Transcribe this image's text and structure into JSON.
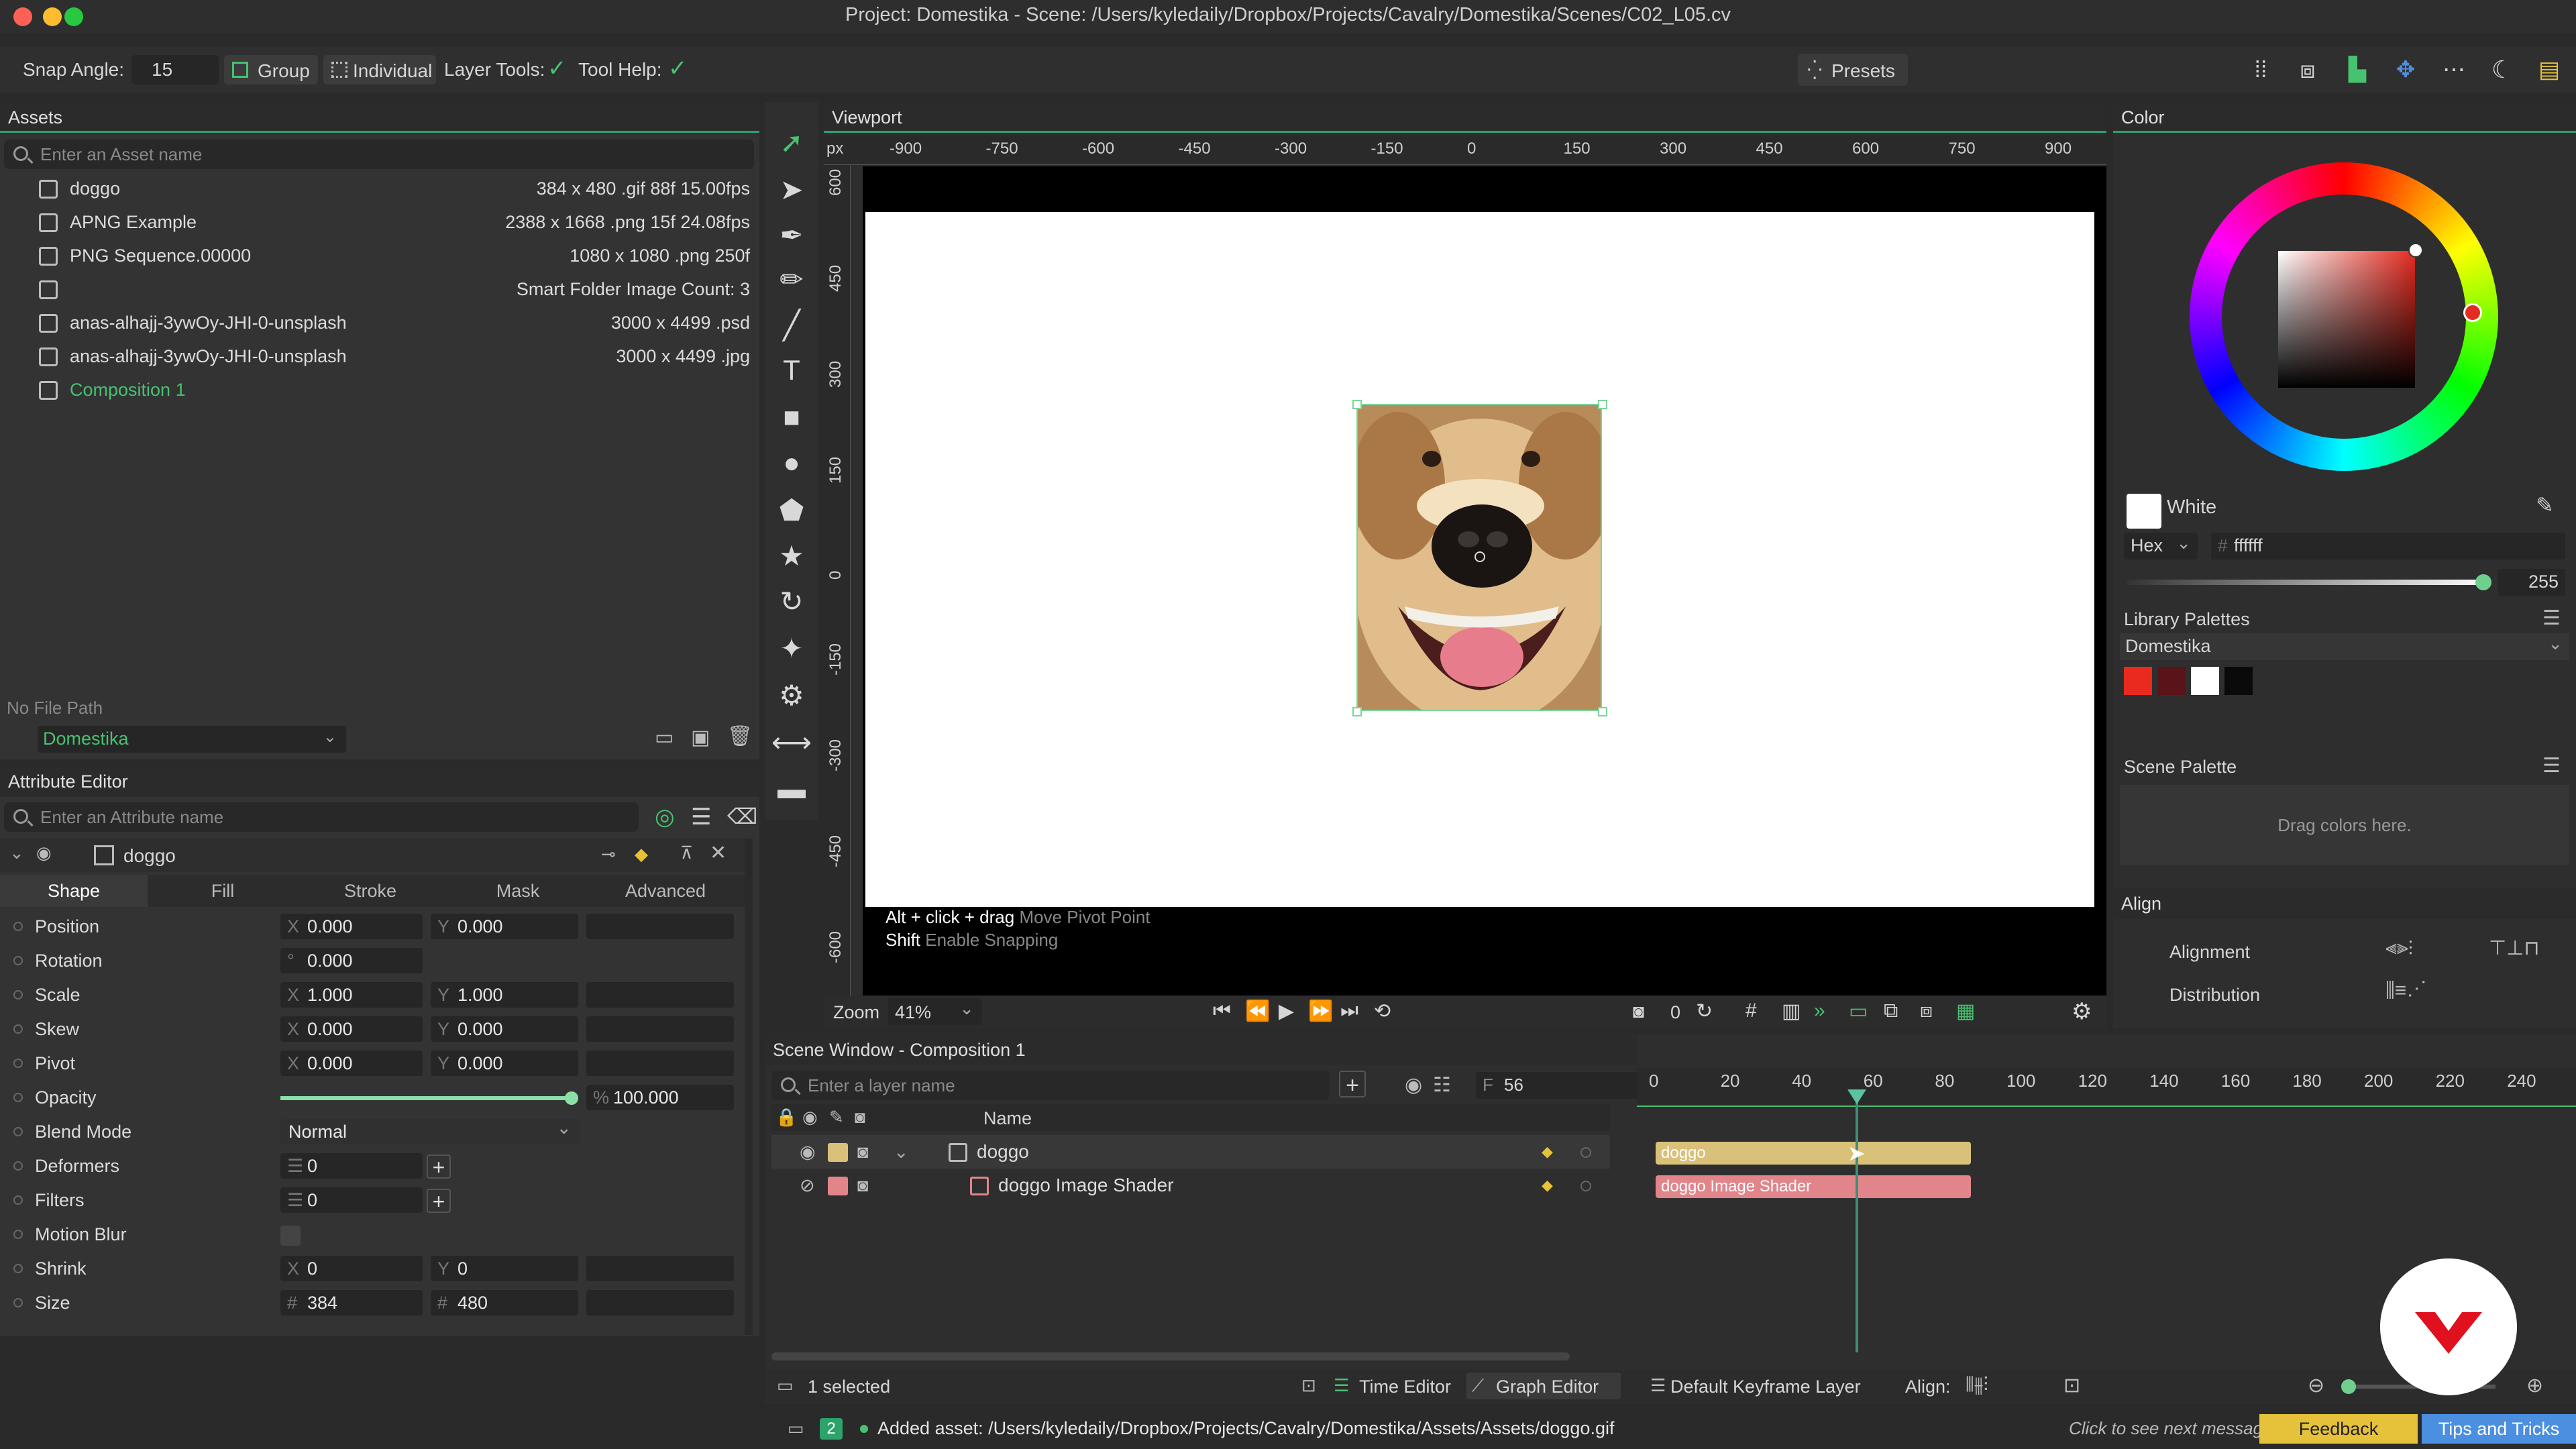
{
  "window": {
    "title": "Project: Domestika - Scene: /Users/kyledaily/Dropbox/Projects/Cavalry/Domestika/Scenes/C02_L05.cv"
  },
  "toolbar": {
    "snap_label": "Snap Angle:",
    "snap_value": "15",
    "group_label": "Group",
    "individual_label": "Individual",
    "layer_tools_label": "Layer Tools:",
    "tool_help_label": "Tool Help:",
    "presets_label": "Presets"
  },
  "assets": {
    "title": "Assets",
    "search_placeholder": "Enter an Asset name",
    "items": [
      {
        "name": "doggo",
        "info": "384 x 480  .gif  88f  15.00fps"
      },
      {
        "name": "APNG Example",
        "info": "2388 x 1668  .png  15f  24.08fps"
      },
      {
        "name": "PNG Sequence.00000",
        "info": "1080 x 1080  .png  250f"
      },
      {
        "name": "",
        "info": "Smart Folder  Image Count: 3"
      },
      {
        "name": "anas-alhajj-3ywOy-JHI-0-unsplash",
        "info": "3000 x 4499  .psd"
      },
      {
        "name": "anas-alhajj-3ywOy-JHI-0-unsplash",
        "info": "3000 x 4499  .jpg"
      },
      {
        "name": "Composition 1",
        "info": ""
      }
    ],
    "file_path": "No File Path",
    "project": "Domestika"
  },
  "attr": {
    "title": "Attribute Editor",
    "search_placeholder": "Enter an Attribute name",
    "layer_name": "doggo",
    "tabs": [
      "Shape",
      "Fill",
      "Stroke",
      "Mask",
      "Advanced"
    ],
    "rows": [
      {
        "label": "Position",
        "a_axis": "X",
        "a": "0.000",
        "b_axis": "Y",
        "b": "0.000"
      },
      {
        "label": "Rotation",
        "a_axis": "°",
        "a": "0.000",
        "b_axis": "",
        "b": ""
      },
      {
        "label": "Scale",
        "a_axis": "X",
        "a": "1.000",
        "b_axis": "Y",
        "b": "1.000"
      },
      {
        "label": "Skew",
        "a_axis": "X",
        "a": "0.000",
        "b_axis": "Y",
        "b": "0.000"
      },
      {
        "label": "Pivot",
        "a_axis": "X",
        "a": "0.000",
        "b_axis": "Y",
        "b": "0.000"
      },
      {
        "label": "Opacity",
        "a_axis": "",
        "a": "",
        "b_axis": "%",
        "b": "100.000"
      },
      {
        "label": "Blend Mode",
        "a_axis": "",
        "a": "Normal",
        "b_axis": "",
        "b": ""
      },
      {
        "label": "Deformers",
        "a_axis": "☰",
        "a": "0",
        "b_axis": "",
        "b": ""
      },
      {
        "label": "Filters",
        "a_axis": "☰",
        "a": "0",
        "b_axis": "",
        "b": ""
      },
      {
        "label": "Motion Blur",
        "a_axis": "",
        "a": "",
        "b_axis": "",
        "b": ""
      },
      {
        "label": "Shrink",
        "a_axis": "X",
        "a": "0",
        "b_axis": "Y",
        "b": "0"
      },
      {
        "label": "Size",
        "a_axis": "#",
        "a": "384",
        "b_axis": "#",
        "b": "480"
      }
    ],
    "opacity_level": 1.0
  },
  "viewport": {
    "title": "Viewport",
    "units": "px",
    "hticks": [
      "-900",
      "-750",
      "-600",
      "-450",
      "-300",
      "-150",
      "0",
      "150",
      "300",
      "450",
      "600",
      "750",
      "900"
    ],
    "vticks": [
      "600",
      "450",
      "300",
      "150",
      "0",
      "-150",
      "-300",
      "-450",
      "-600"
    ],
    "hint1_key": "Alt + click + drag",
    "hint1_text": "Move Pivot Point",
    "hint2_key": "Shift",
    "hint2_text": "Enable Snapping",
    "zoom_label": "Zoom",
    "zoom_value": "41%",
    "frame_count": "0"
  },
  "color": {
    "title": "Color",
    "name": "White",
    "mode": "Hex",
    "hex": "ffffff",
    "alpha": "255",
    "library_title": "Library Palettes",
    "palette_name": "Domestika",
    "swatches": [
      "#ea2a1f",
      "#5a1318",
      "#ffffff",
      "#0a0a0a"
    ],
    "scene_title": "Scene Palette",
    "scene_hint": "Drag colors here.",
    "accent": "#e52b20"
  },
  "align": {
    "title": "Align",
    "alignment_label": "Alignment",
    "distribution_label": "Distribution"
  },
  "scene": {
    "title": "Scene Window - Composition 1",
    "search_placeholder": "Enter a layer name",
    "frame_prefix": "F",
    "frame_value": "56",
    "col_name": "Name",
    "layers": [
      {
        "name": "doggo",
        "color": "#d9c179"
      },
      {
        "name": "doggo Image Shader",
        "color": "#e2858b"
      }
    ],
    "ticks": [
      "0",
      "20",
      "40",
      "60",
      "80",
      "100",
      "120",
      "140",
      "160",
      "180",
      "200",
      "220",
      "240"
    ],
    "playhead_frame": 56,
    "selected": "1 selected",
    "time_editor": "Time Editor",
    "graph_editor": "Graph Editor",
    "keyframe_layer": "Default Keyframe Layer",
    "align_label": "Align:"
  },
  "status": {
    "badge": "2",
    "message": "Added asset: /Users/kyledaily/Dropbox/Projects/Cavalry/Domestika/Assets/Assets/doggo.gif",
    "next_message": "Click to see next message",
    "feedback": "Feedback",
    "tips": "Tips and Tricks"
  }
}
